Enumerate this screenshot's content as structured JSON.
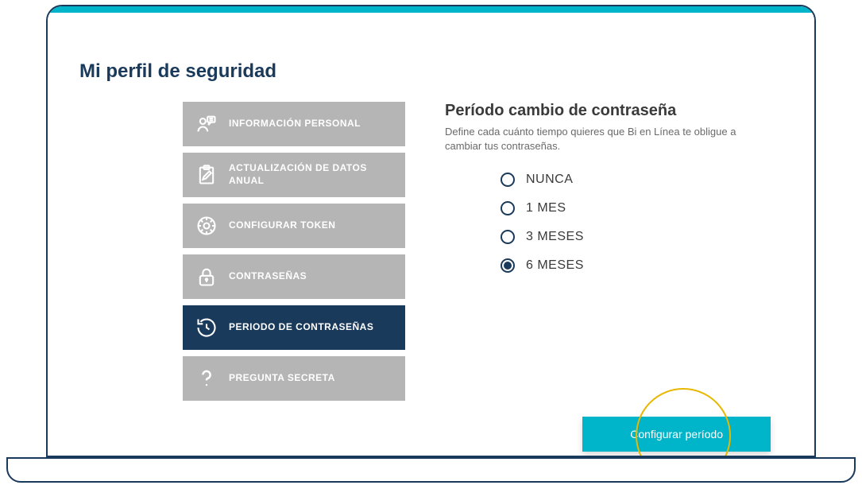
{
  "page": {
    "title": "Mi perfil de seguridad"
  },
  "sidebar": {
    "items": [
      {
        "label": "INFORMACIÓN PERSONAL",
        "icon": "person-speech",
        "active": false
      },
      {
        "label": "ACTUALIZACIÓN DE DATOS ANUAL",
        "icon": "clipboard-edit",
        "active": false
      },
      {
        "label": "CONFIGURAR TOKEN",
        "icon": "gear-circle",
        "active": false
      },
      {
        "label": "CONTRASEÑAS",
        "icon": "lock",
        "active": false
      },
      {
        "label": "PERIODO DE CONTRASEÑAS",
        "icon": "clock-history",
        "active": true
      },
      {
        "label": "PREGUNTA SECRETA",
        "icon": "question",
        "active": false
      }
    ]
  },
  "panel": {
    "title": "Período cambio de contraseña",
    "description": "Define cada cuánto tiempo quieres que Bi en Línea te obligue a cambiar tus contraseñas.",
    "options": [
      {
        "label": "NUNCA",
        "selected": false
      },
      {
        "label": "1 MES",
        "selected": false
      },
      {
        "label": "3 MESES",
        "selected": false
      },
      {
        "label": "6 MESES",
        "selected": true
      }
    ],
    "action_label": "Configurar período"
  },
  "colors": {
    "primary_dark": "#1a3a5c",
    "teal": "#00b5c9",
    "inactive_gray": "#b5b5b5",
    "highlight_ring": "#e8b700"
  }
}
